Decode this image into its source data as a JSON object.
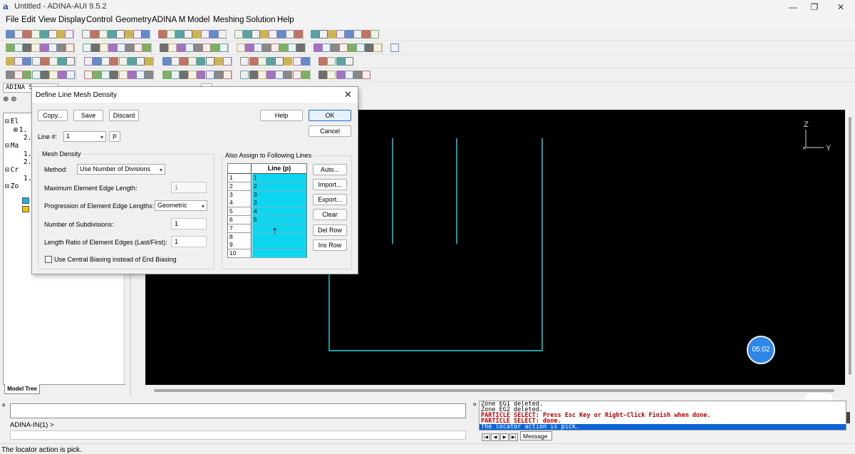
{
  "window": {
    "title": "Untitled - ADINA-AUI  9.5.2",
    "app_icon": "a",
    "controls": [
      "minimize-icon",
      "restore-icon",
      "close-icon"
    ]
  },
  "menu": [
    "File",
    "Edit",
    "View",
    "Display",
    "Control",
    "Geometry",
    "ADINA M",
    "Model",
    "Meshing",
    "Solution",
    "Help"
  ],
  "left_panel": {
    "combo_value": "ADINA S",
    "tree": [
      {
        "expander": "⊟",
        "label": "El"
      },
      {
        "expander": "⊞",
        "label": "1."
      },
      {
        "expander": "",
        "label": "2."
      },
      {
        "expander": "⊟",
        "label": "Ma"
      },
      {
        "expander": "",
        "label": "1."
      },
      {
        "expander": "",
        "label": "2."
      },
      {
        "expander": "⊟",
        "label": "Cr"
      },
      {
        "expander": "",
        "label": "1."
      },
      {
        "expander": "⊟",
        "label": "Zo"
      }
    ],
    "tab_label": "Model Tree"
  },
  "dialog": {
    "title": "Define Line Mesh Density",
    "buttons": {
      "copy": "Copy...",
      "save": "Save",
      "discard": "Discard",
      "help": "Help",
      "ok": "OK",
      "cancel": "Cancel",
      "p": "P"
    },
    "line_label": "Line #:",
    "line_value": "1",
    "mesh_density_group": "Mesh Density",
    "method_label": "Method:",
    "method_value": "Use Number of Divisions",
    "max_edge_label": "Maximum Element Edge Length:",
    "max_edge_value": "1",
    "progression_label": "Progression of Element Edge Lengths:",
    "progression_value": "Geometric",
    "subdivisions_label": "Number of Subdivisions:",
    "subdivisions_value": "1",
    "length_ratio_label": "Length Ratio of Element Edges (Last/First):",
    "length_ratio_value": "1",
    "central_biasing_label": "Use Central Biasing instead of End Biasing",
    "central_biasing_checked": false,
    "also_assign_group": "Also Assign to Following Lines",
    "table_header": "Line (p)",
    "table_rows": [
      {
        "num": "1",
        "val": "1"
      },
      {
        "num": "2",
        "val": "2"
      },
      {
        "num": "3",
        "val": "3"
      },
      {
        "num": "4",
        "val": "3"
      },
      {
        "num": "5",
        "val": "4"
      },
      {
        "num": "6",
        "val": "5"
      },
      {
        "num": "7",
        "val": ""
      },
      {
        "num": "8",
        "val": ""
      },
      {
        "num": "9",
        "val": ""
      },
      {
        "num": "10",
        "val": ""
      }
    ],
    "side_buttons": {
      "auto": "Auto...",
      "import": "Import...",
      "export": "Export...",
      "clear": "Clear",
      "del_row": "Del Row",
      "ins_row": "Ins Row"
    }
  },
  "graphics": {
    "axis_z": "Z",
    "axis_y": "Y",
    "geometry_color": "#2fd8e8",
    "timer": "05:02"
  },
  "command": {
    "prompt": "ADINA-IN(1) >"
  },
  "messages": {
    "lines": [
      {
        "text": "Zone EG1 deleted.",
        "style": "normal"
      },
      {
        "text": "Zone EG2 deleted.",
        "style": "normal"
      },
      {
        "text": "PARTICLE SELECT: Press Esc Key or Right-Click Finish when done.",
        "style": "red"
      },
      {
        "text": "PARTICLE SELECT: done.",
        "style": "red"
      },
      {
        "text": "The locator action is pick.",
        "style": "sel"
      }
    ],
    "tab_label": "Message"
  },
  "status": "The locator action is pick."
}
